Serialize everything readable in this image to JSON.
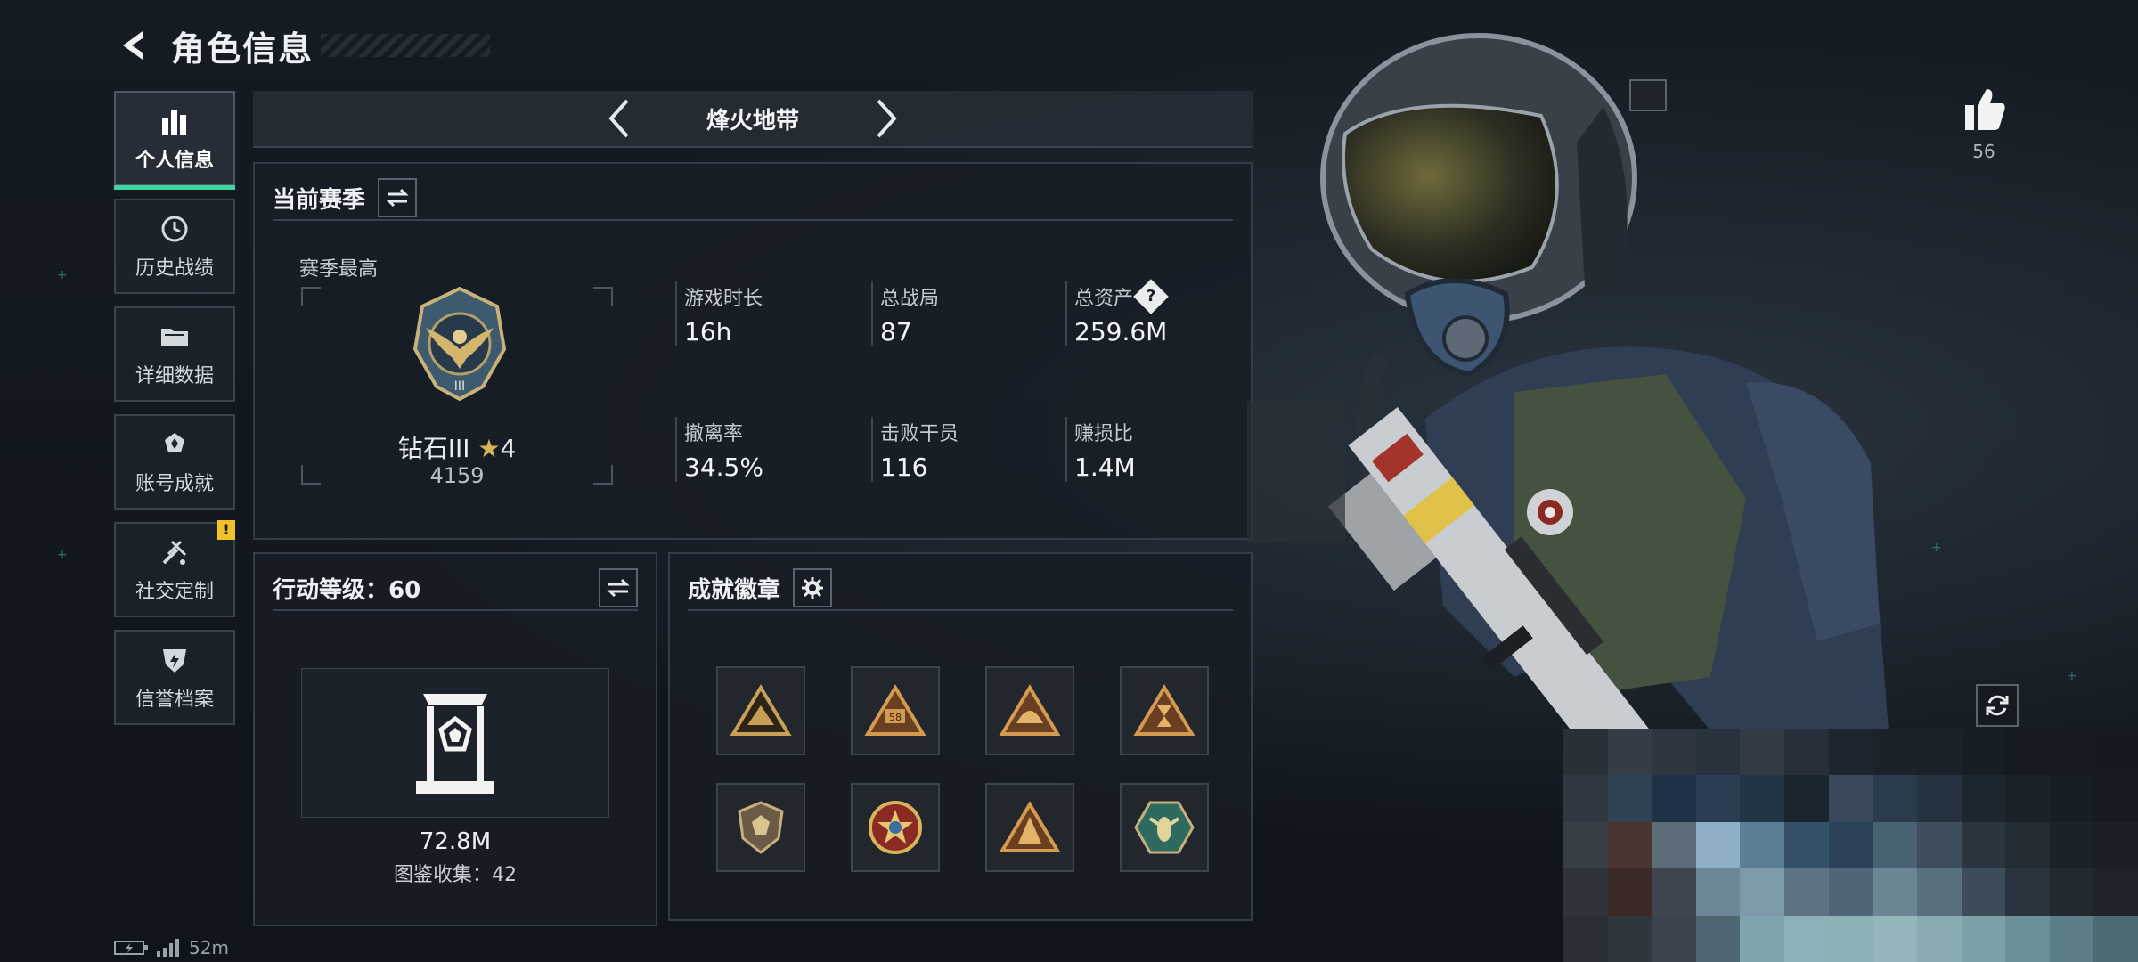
{
  "header": {
    "title": "角色信息"
  },
  "sidebar": {
    "items": [
      {
        "label": "个人信息",
        "icon": "bar-chart-icon",
        "active": true
      },
      {
        "label": "历史战绩",
        "icon": "history-clock-icon"
      },
      {
        "label": "详细数据",
        "icon": "folder-icon"
      },
      {
        "label": "账号成就",
        "icon": "achievement-icon"
      },
      {
        "label": "社交定制",
        "icon": "tools-icon",
        "badge": "!"
      },
      {
        "label": "信誉档案",
        "icon": "shield-bolt-icon"
      }
    ]
  },
  "mode": {
    "label": "烽火地带"
  },
  "season": {
    "title": "当前赛季",
    "high_label": "赛季最高",
    "rank_name": "钻石III",
    "rank_stars": "4",
    "rank_points": "4159",
    "stats": [
      {
        "label": "游戏时长",
        "value": "16h"
      },
      {
        "label": "总战局",
        "value": "87"
      },
      {
        "label": "总资产",
        "value": "259.6M",
        "help": "?"
      },
      {
        "label": "撤离率",
        "value": "34.5%"
      },
      {
        "label": "击败干员",
        "value": "116"
      },
      {
        "label": "赚损比",
        "value": "1.4M"
      }
    ]
  },
  "level": {
    "title": "行动等级：60",
    "value": "72.8M",
    "collection": "图鉴收集：42"
  },
  "badges": {
    "title": "成就徽章",
    "items": [
      "badge-ambush",
      "badge-58",
      "badge-helmet",
      "badge-hourglass",
      "badge-shield",
      "badge-star-medal",
      "badge-triangle",
      "badge-wasp"
    ]
  },
  "likes": {
    "count": "56"
  },
  "status": {
    "text": "52m"
  },
  "colors": {
    "accent": "#3fd6a0",
    "gold": "#d6b45a",
    "alert": "#f0c22a"
  }
}
